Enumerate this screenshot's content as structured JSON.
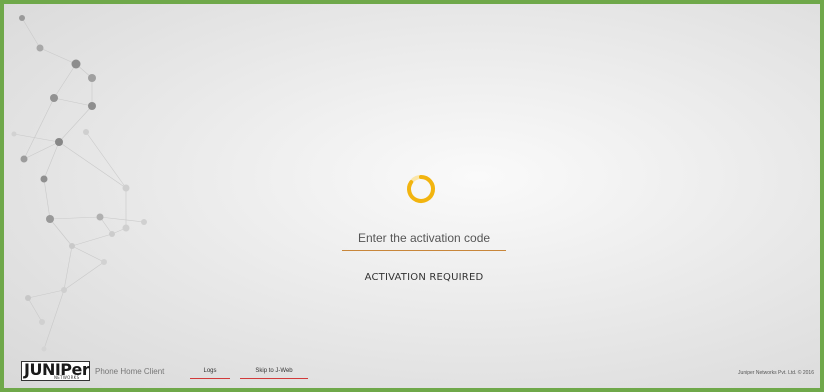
{
  "activation": {
    "placeholder": "Enter the activation code",
    "value": "",
    "status": "ACTIVATION REQUIRED"
  },
  "footer": {
    "logo_text": "JUNIPer",
    "logo_subtext": "NETWORKS",
    "app_name": "Phone Home Client",
    "logs_label": "Logs",
    "skip_label": "Skip to J-Web",
    "copyright": "Juniper Networks Pvt. Ltd. © 2016"
  },
  "colors": {
    "frame_border": "#6fa84a",
    "spinner": "#f2b40f",
    "input_underline": "#c8863a",
    "link_underline": "#d13a3a"
  },
  "icons": {
    "spinner": "loading-spinner-icon",
    "background": "network-nodes-decoration"
  }
}
